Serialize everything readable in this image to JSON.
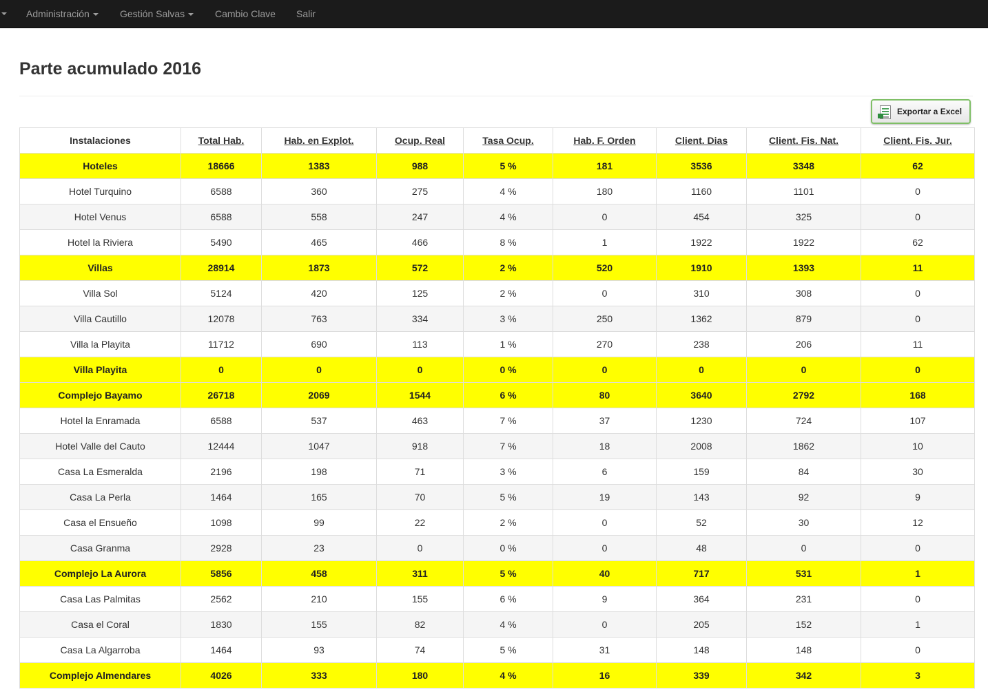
{
  "navbar": {
    "items": [
      {
        "label": "Administración",
        "dropdown": true
      },
      {
        "label": "Gestión Salvas",
        "dropdown": true
      },
      {
        "label": "Cambio Clave",
        "dropdown": false
      },
      {
        "label": "Salir",
        "dropdown": false
      }
    ]
  },
  "page": {
    "title": "Parte acumulado 2016",
    "export_label": "Exportar a Excel",
    "export_icon": "excel-file-icon"
  },
  "colors": {
    "navbar_bg": "#1b1b1b",
    "group_row_bg": "#ffff00",
    "stripe_bg": "#f5f5f5",
    "border": "#dddddd"
  },
  "table": {
    "headers": [
      {
        "label": "Instalaciones",
        "sortable": false
      },
      {
        "label": "Total Hab.",
        "sortable": true
      },
      {
        "label": "Hab. en Explot.",
        "sortable": true
      },
      {
        "label": "Ocup. Real",
        "sortable": true
      },
      {
        "label": "Tasa Ocup.",
        "sortable": true
      },
      {
        "label": "Hab. F. Orden",
        "sortable": true
      },
      {
        "label": "Client. Dias",
        "sortable": true
      },
      {
        "label": "Client. Fis. Nat.",
        "sortable": true
      },
      {
        "label": "Client. Fis. Jur.",
        "sortable": true
      }
    ],
    "rows": [
      {
        "group": true,
        "cells": [
          "Hoteles",
          "18666",
          "1383",
          "988",
          "5 %",
          "181",
          "3536",
          "3348",
          "62"
        ]
      },
      {
        "group": false,
        "cells": [
          "Hotel Turquino",
          "6588",
          "360",
          "275",
          "4 %",
          "180",
          "1160",
          "1101",
          "0"
        ]
      },
      {
        "group": false,
        "cells": [
          "Hotel Venus",
          "6588",
          "558",
          "247",
          "4 %",
          "0",
          "454",
          "325",
          "0"
        ]
      },
      {
        "group": false,
        "cells": [
          "Hotel la Riviera",
          "5490",
          "465",
          "466",
          "8 %",
          "1",
          "1922",
          "1922",
          "62"
        ]
      },
      {
        "group": true,
        "cells": [
          "Villas",
          "28914",
          "1873",
          "572",
          "2 %",
          "520",
          "1910",
          "1393",
          "11"
        ]
      },
      {
        "group": false,
        "cells": [
          "Villa Sol",
          "5124",
          "420",
          "125",
          "2 %",
          "0",
          "310",
          "308",
          "0"
        ]
      },
      {
        "group": false,
        "cells": [
          "Villa Cautillo",
          "12078",
          "763",
          "334",
          "3 %",
          "250",
          "1362",
          "879",
          "0"
        ]
      },
      {
        "group": false,
        "cells": [
          "Villa la Playita",
          "11712",
          "690",
          "113",
          "1 %",
          "270",
          "238",
          "206",
          "11"
        ]
      },
      {
        "group": true,
        "cells": [
          "Villa Playita",
          "0",
          "0",
          "0",
          "0 %",
          "0",
          "0",
          "0",
          "0"
        ]
      },
      {
        "group": true,
        "cells": [
          "Complejo Bayamo",
          "26718",
          "2069",
          "1544",
          "6 %",
          "80",
          "3640",
          "2792",
          "168"
        ]
      },
      {
        "group": false,
        "cells": [
          "Hotel la Enramada",
          "6588",
          "537",
          "463",
          "7 %",
          "37",
          "1230",
          "724",
          "107"
        ]
      },
      {
        "group": false,
        "cells": [
          "Hotel Valle del Cauto",
          "12444",
          "1047",
          "918",
          "7 %",
          "18",
          "2008",
          "1862",
          "10"
        ]
      },
      {
        "group": false,
        "cells": [
          "Casa La Esmeralda",
          "2196",
          "198",
          "71",
          "3 %",
          "6",
          "159",
          "84",
          "30"
        ]
      },
      {
        "group": false,
        "cells": [
          "Casa La Perla",
          "1464",
          "165",
          "70",
          "5 %",
          "19",
          "143",
          "92",
          "9"
        ]
      },
      {
        "group": false,
        "cells": [
          "Casa el Ensueño",
          "1098",
          "99",
          "22",
          "2 %",
          "0",
          "52",
          "30",
          "12"
        ]
      },
      {
        "group": false,
        "cells": [
          "Casa Granma",
          "2928",
          "23",
          "0",
          "0 %",
          "0",
          "48",
          "0",
          "0"
        ]
      },
      {
        "group": true,
        "cells": [
          "Complejo La Aurora",
          "5856",
          "458",
          "311",
          "5 %",
          "40",
          "717",
          "531",
          "1"
        ]
      },
      {
        "group": false,
        "cells": [
          "Casa Las Palmitas",
          "2562",
          "210",
          "155",
          "6 %",
          "9",
          "364",
          "231",
          "0"
        ]
      },
      {
        "group": false,
        "cells": [
          "Casa el Coral",
          "1830",
          "155",
          "82",
          "4 %",
          "0",
          "205",
          "152",
          "1"
        ]
      },
      {
        "group": false,
        "cells": [
          "Casa La Algarroba",
          "1464",
          "93",
          "74",
          "5 %",
          "31",
          "148",
          "148",
          "0"
        ]
      },
      {
        "group": true,
        "cells": [
          "Complejo Almendares",
          "4026",
          "333",
          "180",
          "4 %",
          "16",
          "339",
          "342",
          "3"
        ]
      }
    ]
  }
}
